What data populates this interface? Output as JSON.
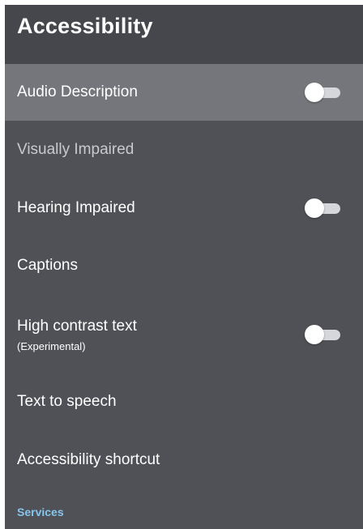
{
  "header": {
    "title": "Accessibility"
  },
  "items": [
    {
      "label": "Audio Description",
      "has_toggle": true,
      "toggle_on": false,
      "selected": true
    },
    {
      "label": "Visually Impaired",
      "dim": true
    },
    {
      "label": "Hearing Impaired",
      "has_toggle": true,
      "toggle_on": false
    },
    {
      "label": "Captions"
    },
    {
      "label": "High contrast text",
      "sublabel": "(Experimental)",
      "has_toggle": true,
      "toggle_on": false
    },
    {
      "label": "Text to speech"
    },
    {
      "label": "Accessibility shortcut"
    }
  ],
  "services": {
    "label": "Services"
  },
  "colors": {
    "background": "#4f5157",
    "header": "#45474d",
    "selected_row": "#74767b",
    "section_label": "#86c5ea"
  }
}
